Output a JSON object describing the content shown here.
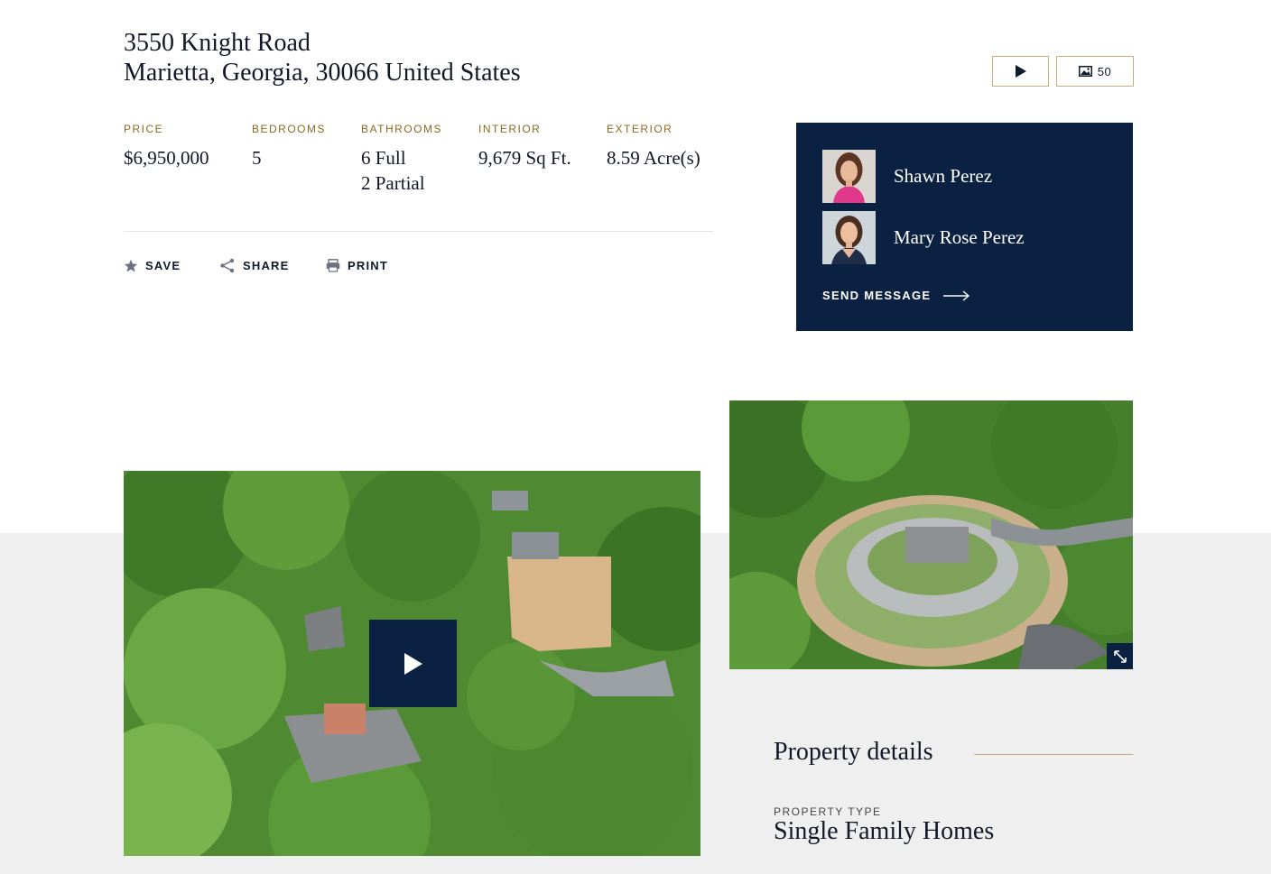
{
  "listing": {
    "address_line1": "3550 Knight Road",
    "address_line2": "Marietta, Georgia, 30066 United States"
  },
  "media": {
    "video_icon": "play-icon",
    "photos_icon": "image-icon",
    "photo_count": "50"
  },
  "stats": {
    "price": {
      "label": "PRICE",
      "value": "$6,950,000"
    },
    "bedrooms": {
      "label": "BEDROOMS",
      "value": "5"
    },
    "bathrooms": {
      "label": "BATHROOMS",
      "value_line1": "6 Full",
      "value_line2": "2 Partial"
    },
    "interior": {
      "label": "INTERIOR",
      "value": "9,679 Sq Ft."
    },
    "exterior": {
      "label": "EXTERIOR",
      "value": "8.59 Acre(s)"
    }
  },
  "actions": {
    "save": "SAVE",
    "share": "SHARE",
    "print": "PRINT"
  },
  "agents": {
    "items": [
      {
        "name": "Shawn Perez"
      },
      {
        "name": "Mary Rose Perez"
      }
    ],
    "send_message": "SEND MESSAGE"
  },
  "details": {
    "title": "Property details",
    "property_type_label": "PROPERTY TYPE",
    "property_type_value": "Single Family Homes"
  },
  "colors": {
    "navy": "#0b2141",
    "gold": "#8a6a1f",
    "rule_gold": "#c9ad7a",
    "section_gray": "#efefef"
  }
}
